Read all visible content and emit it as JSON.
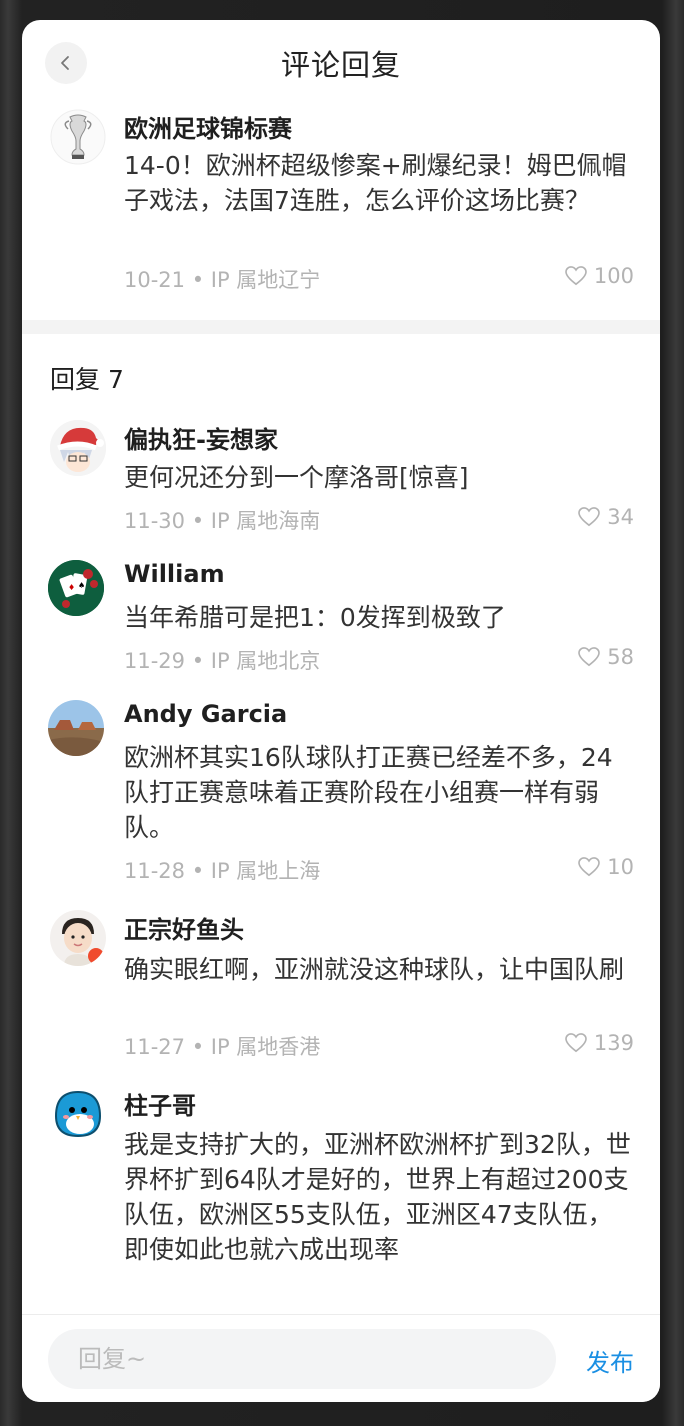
{
  "header": {
    "title": "评论回复"
  },
  "post": {
    "author": "欧洲足球锦标赛",
    "text": "14-0！欧洲杯超级惨案+刷爆纪录！姆巴佩帽子戏法，法国7连胜，怎么评价这场比赛？",
    "meta": "10-21 • IP 属地辽宁",
    "likes": "100"
  },
  "replies_header": "回复 7",
  "comments": [
    {
      "author": "偏执狂-妄想家",
      "text": "更何况还分到一个摩洛哥[惊喜]",
      "meta": "11-30 • IP 属地海南",
      "likes": "34"
    },
    {
      "author": "William",
      "text": "当年希腊可是把1：0发挥到极致了",
      "meta": "11-29 • IP 属地北京",
      "likes": "58"
    },
    {
      "author": "Andy Garcia",
      "text": "欧洲杯其实16队球队打正赛已经差不多，24队打正赛意味着正赛阶段在小组赛一样有弱队。",
      "meta": "11-28 • IP 属地上海",
      "likes": "10"
    },
    {
      "author": "正宗好鱼头",
      "text": "确实眼红啊，亚洲就没这种球队，让中国队刷",
      "meta": "11-27 • IP 属地香港",
      "likes": "139"
    },
    {
      "author": "柱子哥",
      "text": "我是支持扩大的，亚洲杯欧洲杯扩到32队，世界杯扩到64队才是好的，世界上有超过200支队伍，欧洲区55支队伍，亚洲区47支队伍，即使如此也就六成出现率"
    }
  ],
  "bottom": {
    "placeholder": "回复~",
    "publish": "发布"
  }
}
